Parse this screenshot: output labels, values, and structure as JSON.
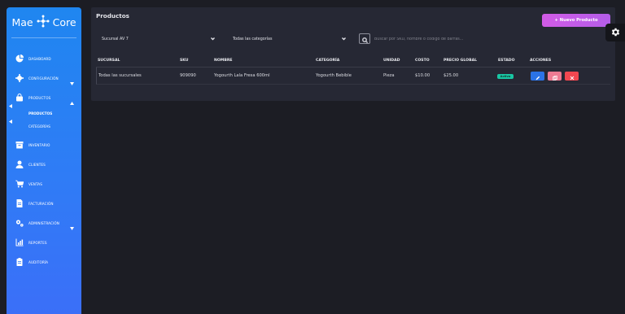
{
  "brand": {
    "left": "Mae",
    "right": "Core",
    "logo_icon": "hub-icon"
  },
  "sidebar": {
    "items": [
      {
        "label": "Dashboard",
        "icon": "pie-chart-icon"
      },
      {
        "label": "Configuración",
        "icon": "gears-icon"
      },
      {
        "label": "Productos",
        "icon": "bag-icon"
      },
      {
        "label": "Inventario",
        "icon": "box-icon"
      },
      {
        "label": "Clientes",
        "icon": "user-icon"
      },
      {
        "label": "Ventas",
        "icon": "cart-icon"
      },
      {
        "label": "Facturación",
        "icon": "invoice-icon"
      },
      {
        "label": "Administración",
        "icon": "cogs-icon"
      },
      {
        "label": "Reportes",
        "icon": "bar-chart-icon"
      },
      {
        "label": "Auditoría",
        "icon": "clipboard-icon"
      }
    ],
    "sub_items": [
      {
        "label": "Productos"
      },
      {
        "label": "Categorías"
      }
    ]
  },
  "main": {
    "title": "Productos",
    "new_button": "Nuevo Producto",
    "filters": {
      "branch": "Sucursal AV 7",
      "category": "Todas las categorías",
      "search_placeholder": "Buscar por SKU, nombre o código de barras..."
    },
    "table": {
      "headers": [
        "Sucursal",
        "SKU",
        "Nombre",
        "Categoría",
        "Unidad",
        "Costo",
        "Precio Global",
        "Estado",
        "Acciones"
      ],
      "rows": [
        {
          "sucursal": "Todas las sucursales",
          "sku": "909090",
          "nombre": "Yogourth Lala Fresa 600ml",
          "categoria": "Yogourth Bebible",
          "unidad": "Pieza",
          "costo": "$10.00",
          "precio": "$25.00",
          "estado": "Activo"
        }
      ]
    }
  },
  "colors": {
    "background": "#1c1d24",
    "card": "#262834",
    "sidebar_gradient_top": "#1f86f0",
    "sidebar_gradient_bottom": "#3b6ff8",
    "primary_button": "#d15be6",
    "status_active": "#19c6a3",
    "edit": "#2b73e6",
    "copy": "#ee7b93",
    "delete": "#f24750"
  }
}
